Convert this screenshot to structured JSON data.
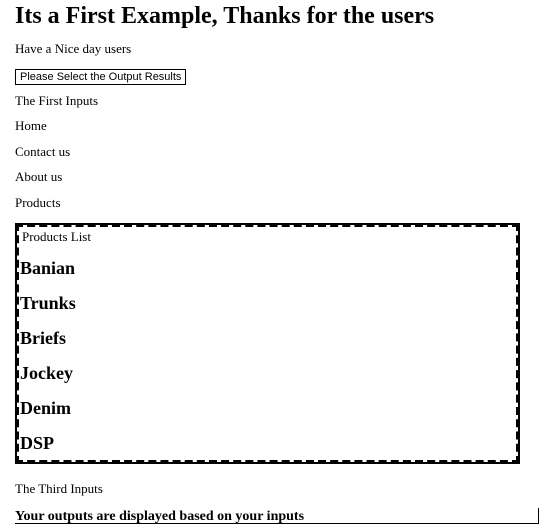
{
  "heading": "Its a First Example, Thanks for the users",
  "greeting": "Have a Nice day users",
  "button_label": "Please Select the Output Results",
  "first_inputs_label": "The First Inputs",
  "nav_items": [
    "Home",
    "Contact us",
    "About us",
    "Products"
  ],
  "products_box": {
    "title": "Products List",
    "items": [
      "Banian",
      "Trunks",
      "Briefs",
      "Jockey",
      "Denim",
      "DSP"
    ]
  },
  "third_inputs_label": "The Third Inputs",
  "outputs_text": "Your outputs are displayed based on your inputs"
}
